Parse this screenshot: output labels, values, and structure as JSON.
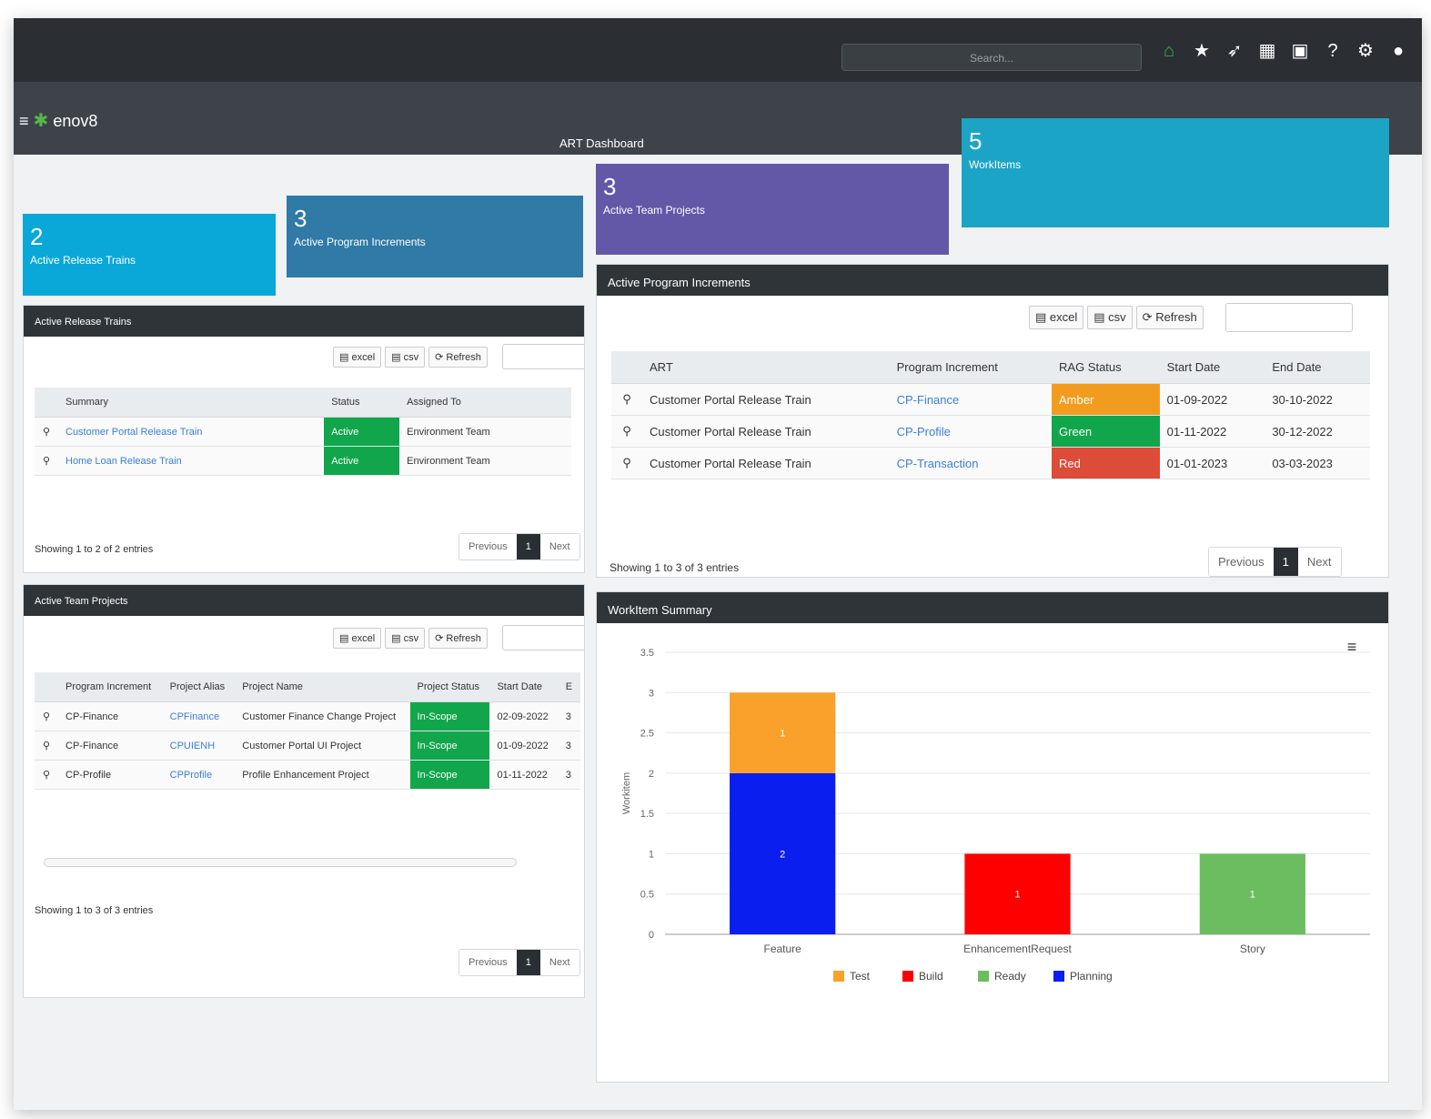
{
  "header": {
    "search_placeholder": "Search...",
    "icons": [
      "home-icon",
      "star-icon",
      "rocket-icon",
      "clapper-icon",
      "chat-icon",
      "help-icon",
      "settings-icon",
      "user-icon"
    ]
  },
  "brand": {
    "logo_text": "enov8",
    "menu_icon": "hamburger-icon"
  },
  "dashboard": {
    "title": "ART Dashboard"
  },
  "tiles": [
    {
      "count": "2",
      "label": "Active Release Trains",
      "color": "#0aa7d9"
    },
    {
      "count": "3",
      "label": "Active Program Increments",
      "color": "#2f7aa6"
    },
    {
      "count": "3",
      "label": "Active Team Projects",
      "color": "#6357a8"
    },
    {
      "count": "5",
      "label": "WorkItems",
      "color": "#1ca4c6"
    }
  ],
  "buttons": {
    "excel": "excel",
    "csv": "csv",
    "refresh": "Refresh"
  },
  "release_trains": {
    "title": "Active Release Trains",
    "columns": [
      "Summary",
      "Status",
      "Assigned To"
    ],
    "rows": [
      {
        "summary": "Customer Portal Release Train",
        "status": "Active",
        "assigned": "Environment Team"
      },
      {
        "summary": "Home Loan Release Train",
        "status": "Active",
        "assigned": "Environment Team"
      }
    ],
    "info": "Showing 1 to 2 of 2 entries"
  },
  "program_increments": {
    "title": "Active Program Increments",
    "columns": [
      "ART",
      "Program Increment",
      "RAG Status",
      "Start Date",
      "End Date"
    ],
    "rows": [
      {
        "art": "Customer Portal Release Train",
        "pi": "CP-Finance",
        "rag": "Amber",
        "start": "01-09-2022",
        "end": "30-10-2022"
      },
      {
        "art": "Customer Portal Release Train",
        "pi": "CP-Profile",
        "rag": "Green",
        "start": "01-11-2022",
        "end": "30-12-2022"
      },
      {
        "art": "Customer Portal Release Train",
        "pi": "CP-Transaction",
        "rag": "Red",
        "start": "01-01-2023",
        "end": "03-03-2023"
      }
    ],
    "info": "Showing 1 to 3 of 3 entries"
  },
  "team_projects": {
    "title": "Active Team Projects",
    "columns": [
      "Program Increment",
      "Project Alias",
      "Project Name",
      "Project Status",
      "Start Date",
      "E"
    ],
    "rows": [
      {
        "pi": "CP-Finance",
        "alias": "CPFinance",
        "name": "Customer Finance Change Project",
        "status": "In-Scope",
        "start": "02-09-2022",
        "end": "3"
      },
      {
        "pi": "CP-Finance",
        "alias": "CPUIENH",
        "name": "Customer Portal UI Project",
        "status": "In-Scope",
        "start": "01-09-2022",
        "end": "3"
      },
      {
        "pi": "CP-Profile",
        "alias": "CPProfile",
        "name": "Profile Enhancement Project",
        "status": "In-Scope",
        "start": "01-11-2022",
        "end": "3"
      }
    ],
    "info": "Showing 1 to 3 of 3 entries"
  },
  "pager": {
    "previous": "Previous",
    "current": "1",
    "next": "Next"
  },
  "workitem_summary": {
    "title": "WorkItem Summary",
    "menu_icon": "chart-menu-icon"
  },
  "chart_data": {
    "type": "bar",
    "stacked": true,
    "categories": [
      "Feature",
      "EnhancementRequest",
      "Story"
    ],
    "series": [
      {
        "name": "Test",
        "color": "#f9a12a",
        "values": [
          1,
          0,
          0
        ]
      },
      {
        "name": "Build",
        "color": "#ff0000",
        "values": [
          0,
          1,
          0
        ]
      },
      {
        "name": "Ready",
        "color": "#6cbd5f",
        "values": [
          0,
          0,
          1
        ]
      },
      {
        "name": "Planning",
        "color": "#0a1ef0",
        "values": [
          2,
          0,
          0
        ]
      }
    ],
    "stack_order_bottom_to_top": [
      "Planning",
      "Ready",
      "Build",
      "Test"
    ],
    "ylabel": "Workitem",
    "ylim": [
      0,
      3.5
    ],
    "yticks": [
      "0",
      "0.5",
      "1",
      "1.5",
      "2",
      "2.5",
      "3",
      "3.5"
    ],
    "grid": true,
    "legend": "bottom"
  }
}
